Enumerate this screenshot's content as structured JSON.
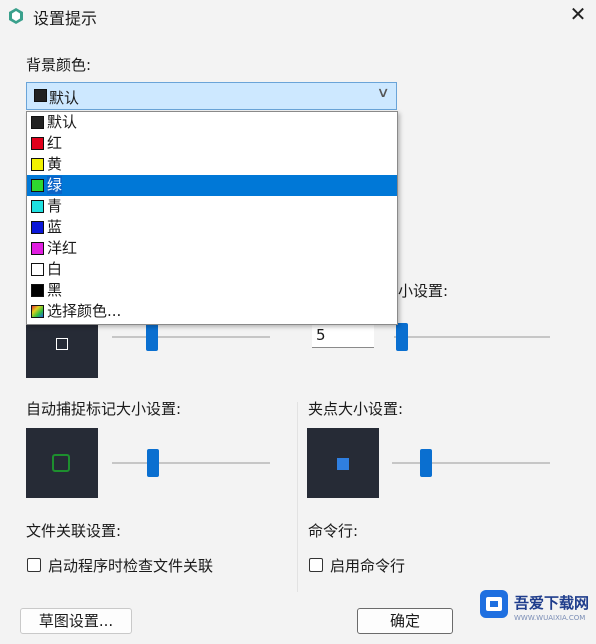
{
  "window": {
    "title": "设置提示",
    "close_glyph": "✕"
  },
  "background_color": {
    "label": "背景颜色:",
    "selected": "默认",
    "options": [
      {
        "label": "默认",
        "swatch": "#222222",
        "selected": false
      },
      {
        "label": "红",
        "swatch": "#e0001b",
        "selected": false
      },
      {
        "label": "黄",
        "swatch": "#f2f200",
        "selected": false
      },
      {
        "label": "绿",
        "swatch": "#2ed82e",
        "selected": true
      },
      {
        "label": "青",
        "swatch": "#1fe0e0",
        "selected": false
      },
      {
        "label": "蓝",
        "swatch": "#0b17d8",
        "selected": false
      },
      {
        "label": "洋红",
        "swatch": "#e01ee0",
        "selected": false
      },
      {
        "label": "白",
        "swatch": "#ffffff",
        "selected": false
      },
      {
        "label": "黑",
        "swatch": "#000000",
        "selected": false
      },
      {
        "label": "选择颜色...",
        "swatch": "palette",
        "selected": false
      }
    ]
  },
  "partially_hidden_label": "小设置:",
  "size_input_value": "5",
  "sliders": {
    "left_top_level": 0.3,
    "right_top_level": 0.1,
    "snap_mark_level": 0.25,
    "grip_level": 0.25
  },
  "snap_mark": {
    "label": "自动捕捉标记大小设置:",
    "marker_color": "#1d8f2e"
  },
  "grip": {
    "label": "夹点大小设置:",
    "marker_color": "#2f7fe0"
  },
  "file_association": {
    "label": "文件关联设置:",
    "checkbox_label": "启动程序时检查文件关联",
    "checked": false
  },
  "command_line": {
    "label": "命令行:",
    "checkbox_label": "启用命令行",
    "checked": false
  },
  "buttons": {
    "sketch_settings": "草图设置...",
    "ok": "确定"
  },
  "watermark": {
    "brand": "吾爱下载网",
    "sub": "WWW.WUAIXIA.COM"
  }
}
